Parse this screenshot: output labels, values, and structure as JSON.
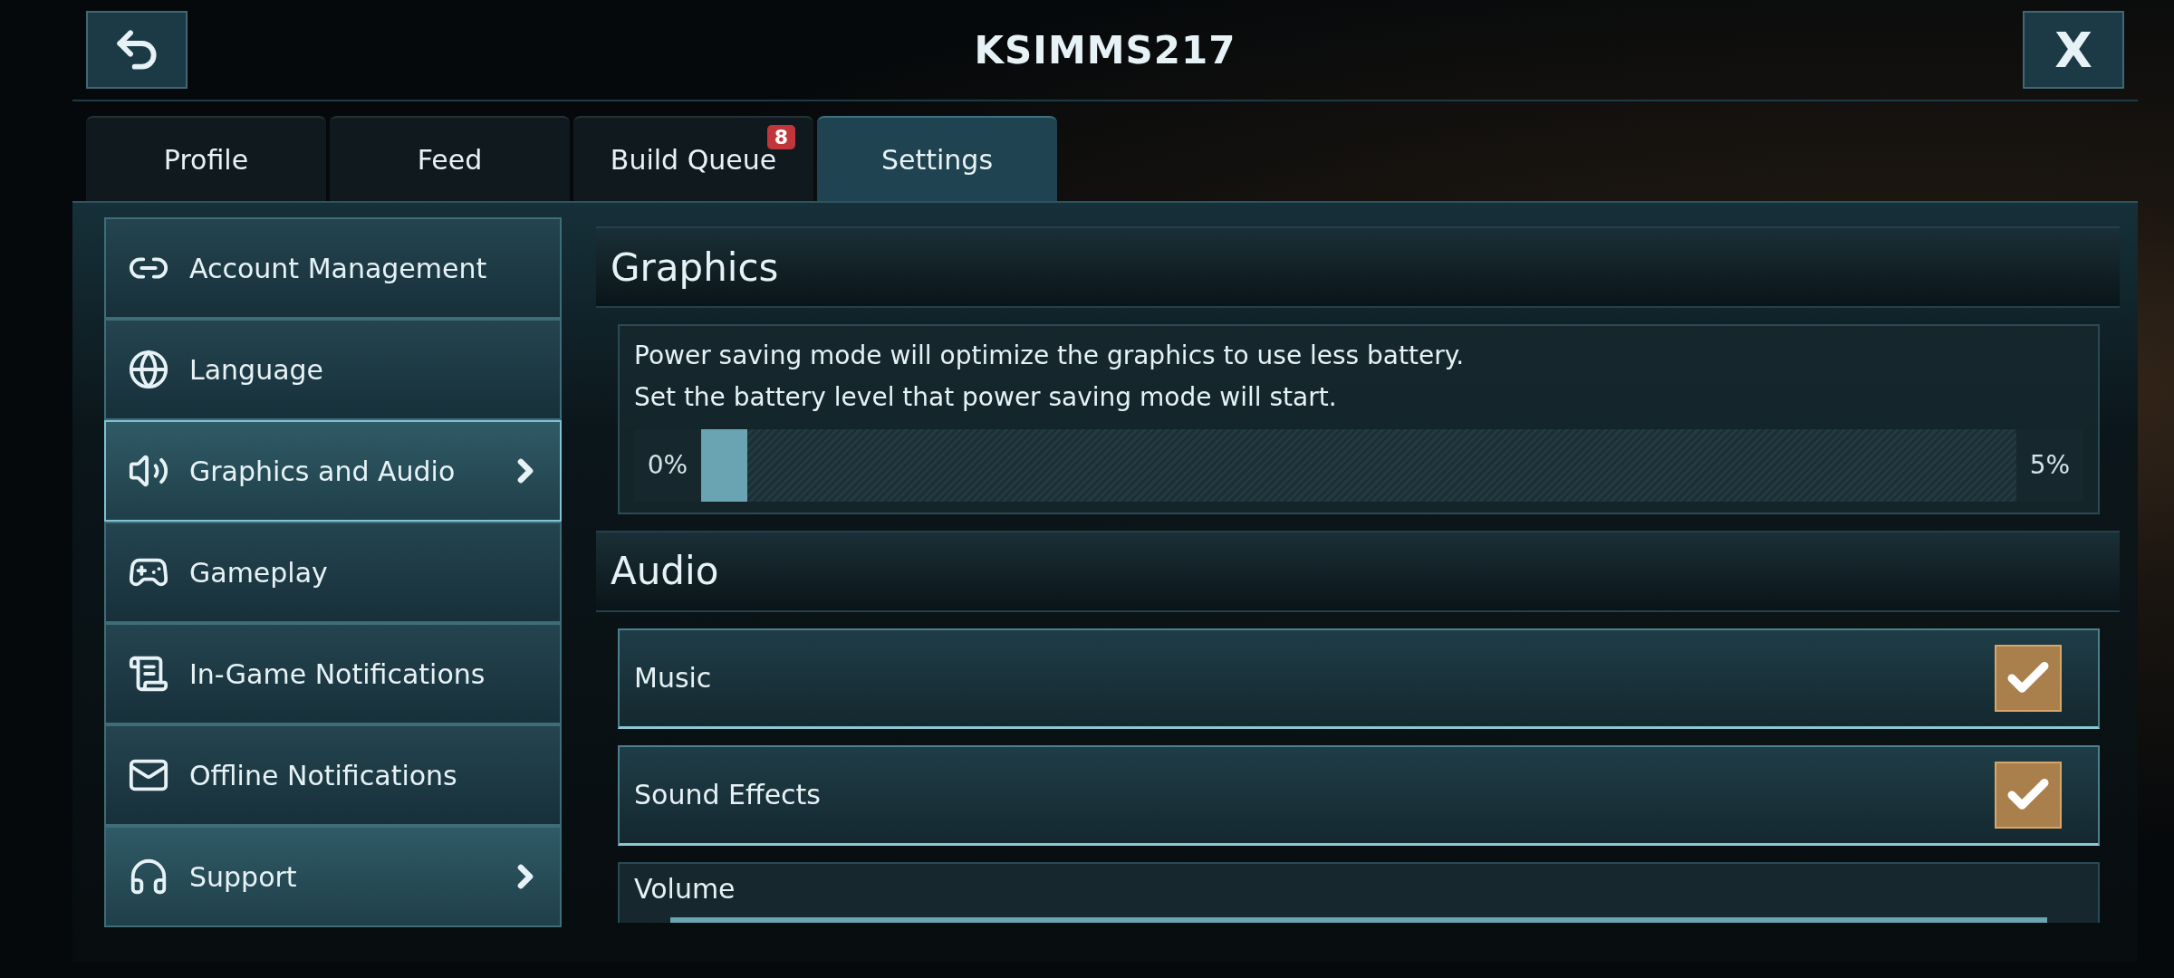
{
  "header": {
    "title": "KSIMMS217",
    "close_label": "X"
  },
  "tabs": [
    {
      "label": "Profile",
      "selected": false
    },
    {
      "label": "Feed",
      "selected": false
    },
    {
      "label": "Build Queue",
      "selected": false,
      "badge": "8"
    },
    {
      "label": "Settings",
      "selected": true
    }
  ],
  "sidebar": {
    "items": [
      {
        "label": "Account Management",
        "selected": false,
        "has_arrow": false
      },
      {
        "label": "Language",
        "selected": false,
        "has_arrow": false
      },
      {
        "label": "Graphics and Audio",
        "selected": true,
        "has_arrow": true
      },
      {
        "label": "Gameplay",
        "selected": false,
        "has_arrow": false
      },
      {
        "label": "In-Game Notifications",
        "selected": false,
        "has_arrow": false
      },
      {
        "label": "Offline Notifications",
        "selected": false,
        "has_arrow": false
      },
      {
        "label": "Support",
        "selected": false,
        "has_arrow": true
      }
    ]
  },
  "graphics": {
    "title": "Graphics",
    "description": [
      "Power saving mode will optimize the graphics to use less battery.",
      "Set the battery level that power saving mode will start."
    ],
    "slider": {
      "min_label": "0%",
      "max_label": "5%",
      "level": 0.035
    }
  },
  "audio": {
    "title": "Audio",
    "rows": [
      {
        "kind": "checkbox",
        "label": "Music",
        "checked": true
      },
      {
        "kind": "checkbox",
        "label": "Sound Effects",
        "checked": true
      },
      {
        "kind": "slider",
        "label": "Volume"
      }
    ]
  }
}
